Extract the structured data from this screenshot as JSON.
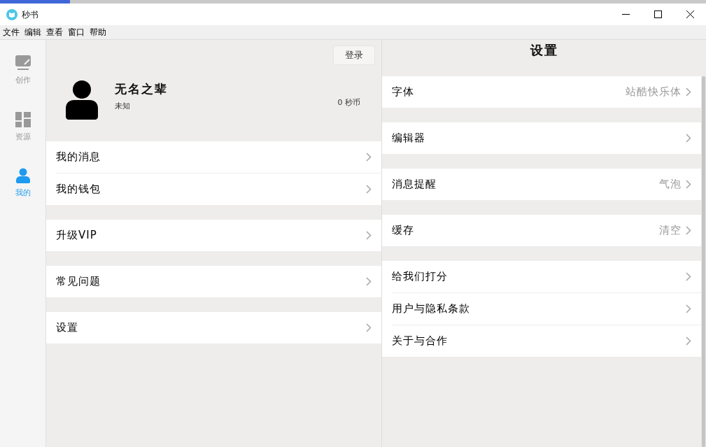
{
  "window": {
    "title": "秒书"
  },
  "menu": [
    "文件",
    "编辑",
    "查看",
    "窗口",
    "帮助"
  ],
  "sidebar": {
    "items": [
      {
        "label": "创作",
        "kind": "edit",
        "selected": false
      },
      {
        "label": "资源",
        "kind": "grid",
        "selected": false
      },
      {
        "label": "我的",
        "kind": "person",
        "selected": true
      }
    ]
  },
  "profile": {
    "login_button": "登录",
    "name": "无名之辈",
    "subtitle": "未知",
    "coins": "0 秒币"
  },
  "account_groups": [
    {
      "items": [
        "我的消息",
        "我的钱包"
      ]
    },
    {
      "items": [
        "升级VIP"
      ]
    },
    {
      "items": [
        "常见问题"
      ]
    },
    {
      "items": [
        "设置"
      ]
    }
  ],
  "settings": {
    "title": "设置",
    "groups": [
      {
        "items": [
          {
            "label": "字体",
            "value": "站酷快乐体"
          }
        ]
      },
      {
        "items": [
          {
            "label": "编辑器"
          }
        ]
      },
      {
        "items": [
          {
            "label": "消息提醒",
            "value": "气泡"
          }
        ]
      },
      {
        "items": [
          {
            "label": "缓存",
            "value": "清空"
          }
        ]
      },
      {
        "items": [
          {
            "label": "给我们打分"
          },
          {
            "label": "用户与隐私条款"
          },
          {
            "label": "关于与合作"
          }
        ]
      }
    ]
  }
}
